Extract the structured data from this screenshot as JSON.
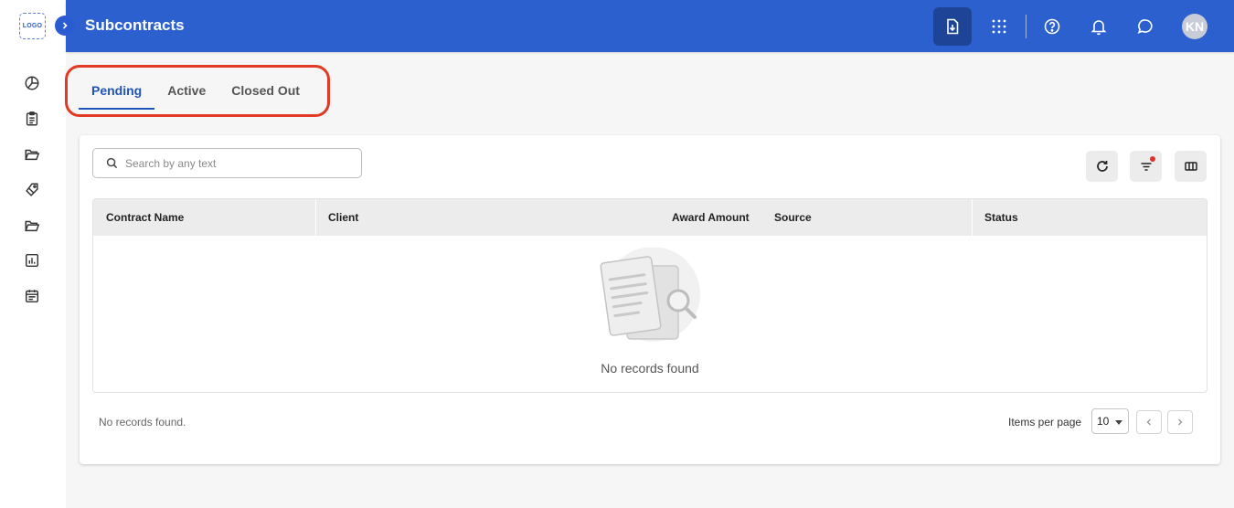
{
  "sidebar": {
    "logo_text": "LOGO",
    "icons": [
      "dashboard-pie-icon",
      "clipboard-icon",
      "folder-open-icon",
      "tags-icon",
      "folder-icon",
      "report-chart-icon",
      "calendar-icon"
    ]
  },
  "header": {
    "title": "Subcontracts",
    "avatar_initials": "KN",
    "colors": {
      "bar": "#2c60cf",
      "active_button": "#1d4496"
    }
  },
  "tabs": [
    {
      "label": "Pending",
      "active": true
    },
    {
      "label": "Active",
      "active": false
    },
    {
      "label": "Closed Out",
      "active": false
    }
  ],
  "search": {
    "placeholder": "Search by any text",
    "value": ""
  },
  "table": {
    "columns": [
      "Contract Name",
      "Client",
      "Award Amount",
      "Source",
      "Status"
    ],
    "rows": [],
    "empty_message": "No records found"
  },
  "footer": {
    "status_text": "No records found.",
    "items_per_page_label": "Items per page",
    "items_per_page_value": "10"
  },
  "colors": {
    "accent": "#1f55b8",
    "highlight_outline": "#e23a24",
    "filter_badge": "#d9342b"
  }
}
